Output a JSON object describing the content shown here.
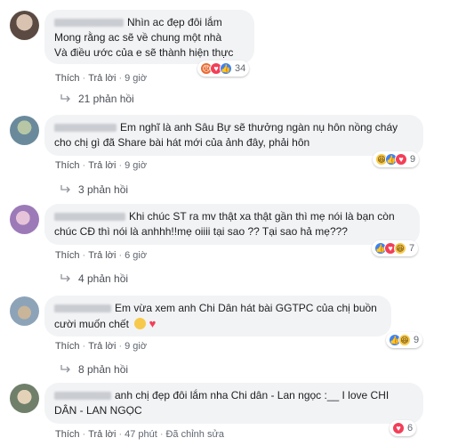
{
  "comments": [
    {
      "lines": [
        "Nhìn ac đẹp đôi lắm",
        "Mong rằng ac sẽ về chung một nhà",
        "Và điều ước của e sẽ thành hiện thực"
      ],
      "actions": {
        "like": "Thích",
        "reply": "Trả lời",
        "time": "9 giờ"
      },
      "reactions": {
        "icons": [
          "angry-icon",
          "love-icon",
          "like-icon"
        ],
        "count": "34"
      },
      "replies": "21 phản hồi"
    },
    {
      "lines": [
        "Em nghĩ là anh Sâu Bự sẽ thưởng ngàn nụ hôn nồng cháy",
        "cho chị gì đã Share bài hát mới của ảnh đây, phải hôn"
      ],
      "actions": {
        "like": "Thích",
        "reply": "Trả lời",
        "time": "9 giờ"
      },
      "reactions": {
        "icons": [
          "haha-icon",
          "like-icon",
          "love-icon"
        ],
        "count": "9"
      },
      "replies": "3 phản hồi"
    },
    {
      "lines": [
        "Khi chúc ST ra mv thật xa thật gần thì mẹ nói là bạn còn",
        "chúc CĐ thì nói là anhhh!!mẹ oiiii tại sao ?? Tại sao hả mẹ???"
      ],
      "actions": {
        "like": "Thích",
        "reply": "Trả lời",
        "time": "6 giờ"
      },
      "reactions": {
        "icons": [
          "like-icon",
          "love-icon",
          "haha-icon"
        ],
        "count": "7"
      },
      "replies": "4 phản hồi"
    },
    {
      "lines": [
        "Em vừa xem anh Chi Dân hát bài GGTPC của chị buồn",
        "cười muốn chết"
      ],
      "actions": {
        "like": "Thích",
        "reply": "Trả lời",
        "time": "9 giờ"
      },
      "reactions": {
        "icons": [
          "like-icon",
          "haha-icon"
        ],
        "count": "9"
      },
      "replies": "8 phản hồi"
    },
    {
      "lines": [
        "anh chị đẹp đôi lắm nha Chi dân - Lan ngọc :__ I love CHI",
        "DÂN - LAN NGỌC"
      ],
      "actions": {
        "like": "Thích",
        "reply": "Trả lời",
        "time": "47 phút",
        "edited": "Đã chỉnh sửa"
      },
      "reactions": {
        "icons": [
          "love-icon"
        ],
        "count": "6"
      }
    }
  ],
  "colors": {
    "bubble": "#f2f3f5",
    "link": "#4b4f56",
    "like": "#3b82f6",
    "love": "#f33e58"
  }
}
